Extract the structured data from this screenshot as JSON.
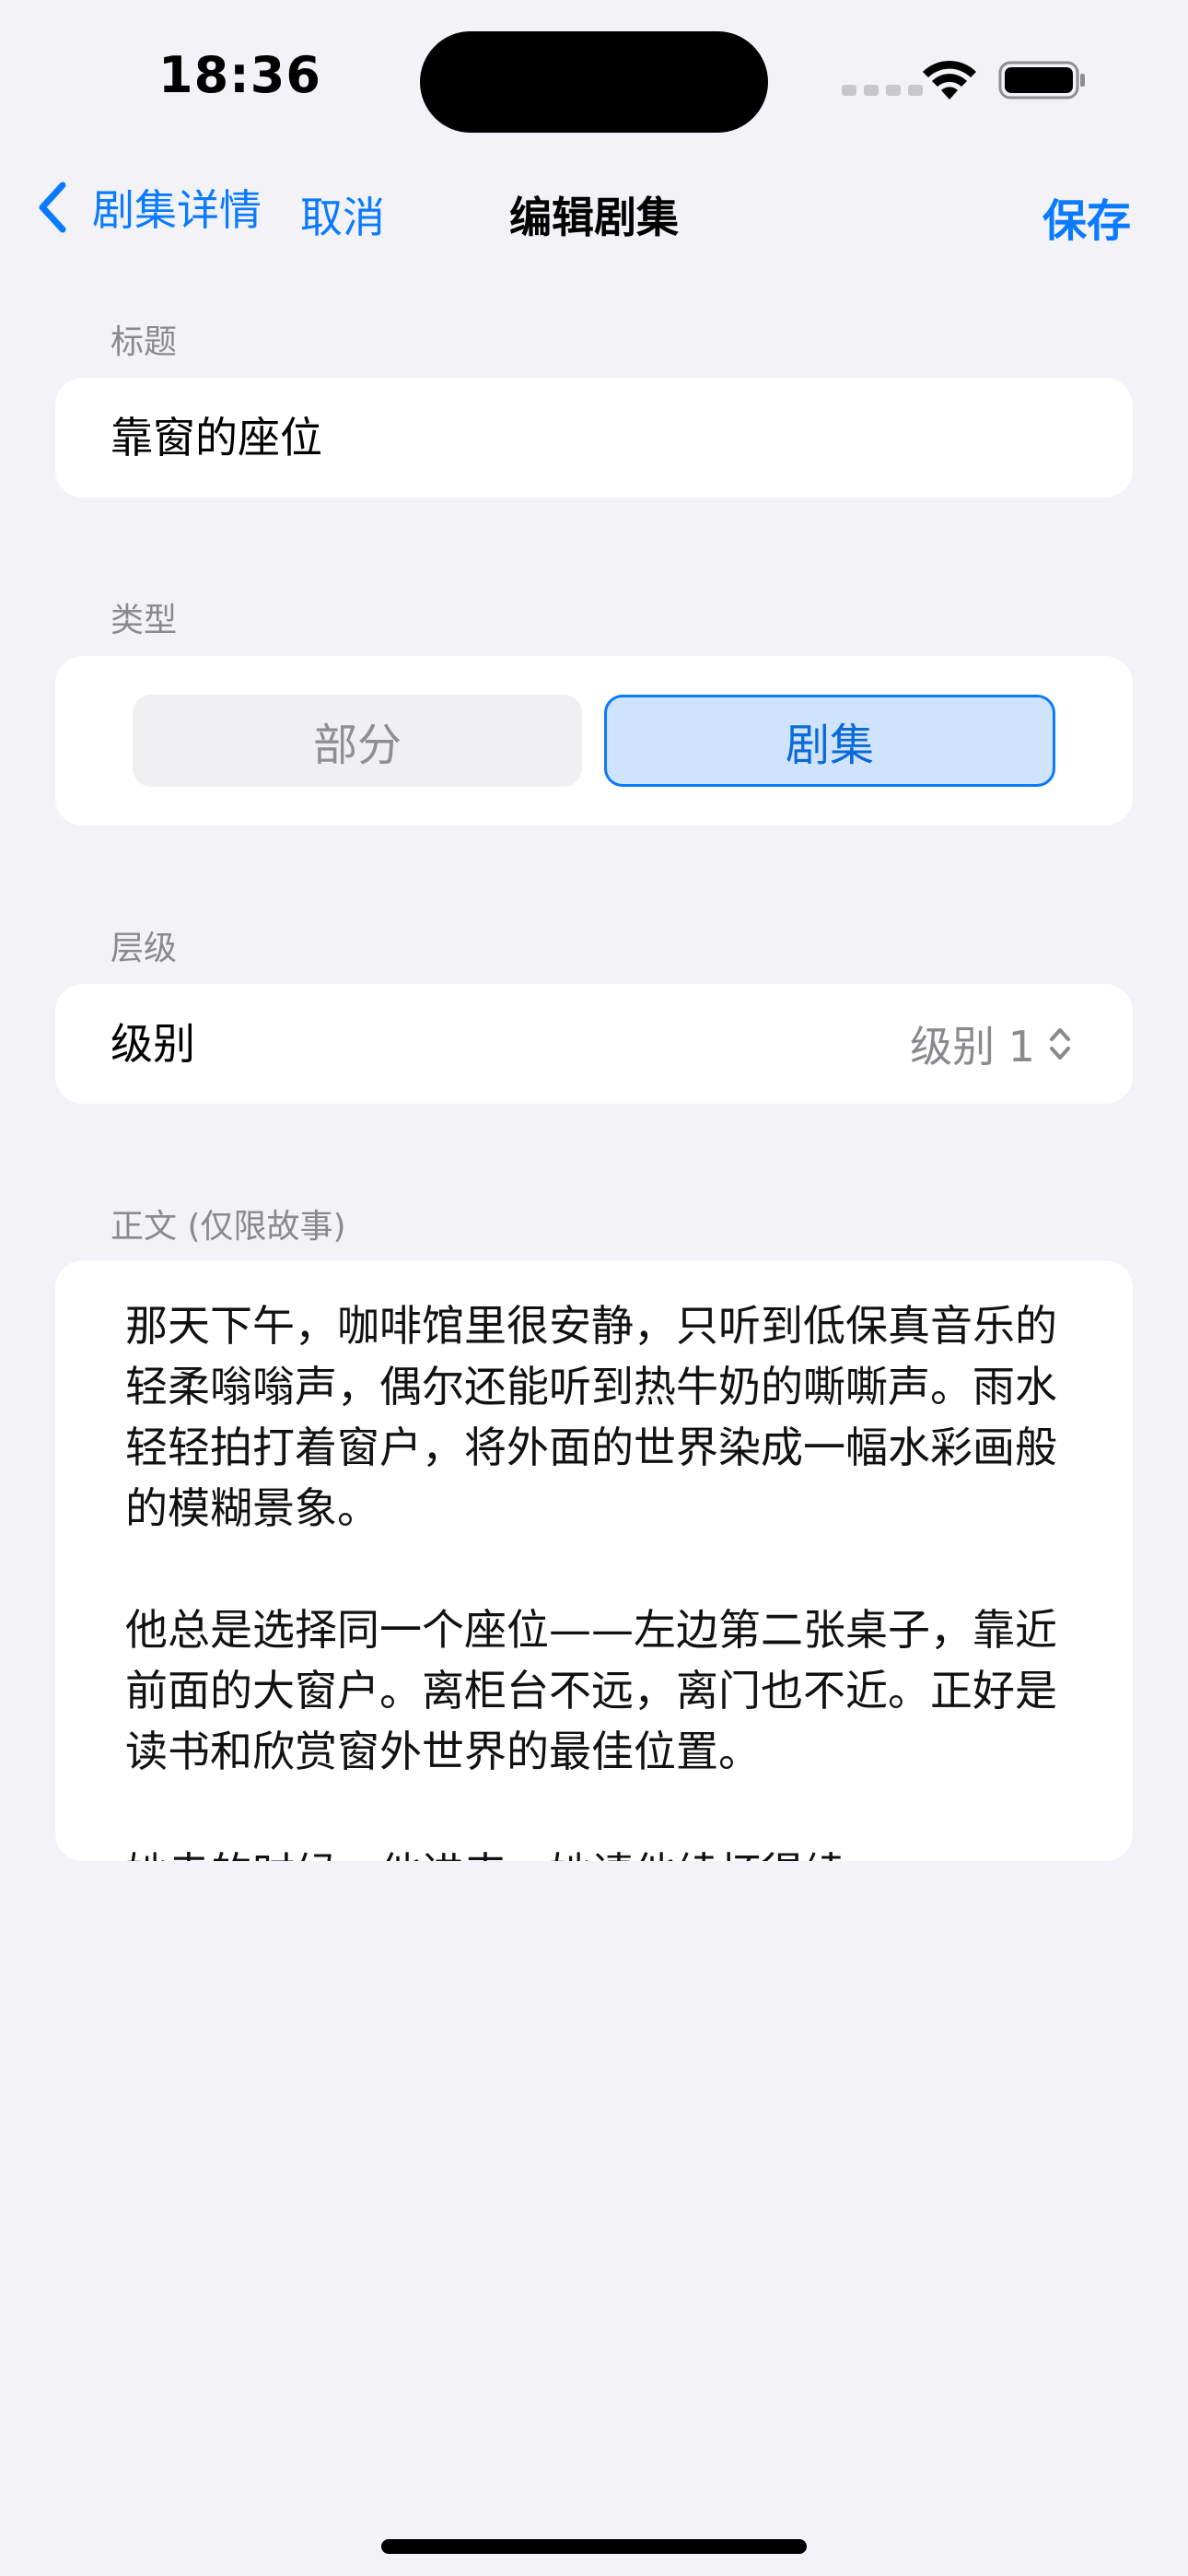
{
  "status_bar": {
    "time": "18:36"
  },
  "nav": {
    "back_label": "剧集详情",
    "cancel_label": "取消",
    "title": "编辑剧集",
    "save_label": "保存",
    "accent_color": "#0a7aff"
  },
  "title_section": {
    "label": "标题",
    "value": "靠窗的座位"
  },
  "type_section": {
    "label": "类型",
    "options": [
      "部分",
      "剧集"
    ],
    "selected": "剧集"
  },
  "hierarchy_section": {
    "label": "层级",
    "row_label": "级别",
    "value": "级别 1"
  },
  "body_section": {
    "label": "正文 (仅限故事)",
    "paragraphs": [
      "那天下午，咖啡馆里很安静，只听到低保真音乐的轻柔嗡嗡声，偶尔还能听到热牛奶的嘶嘶声。雨水轻轻拍打着窗户，将外面的世界染成一幅水彩画般的模糊景象。",
      "他总是选择同一个座位——左边第二张桌子，靠近前面的大窗户。离柜台不远，离门也不近。正好是读书和欣赏窗外世界的最佳位置。",
      "她走的时候，他进来，她请他续杯得续。"
    ]
  }
}
